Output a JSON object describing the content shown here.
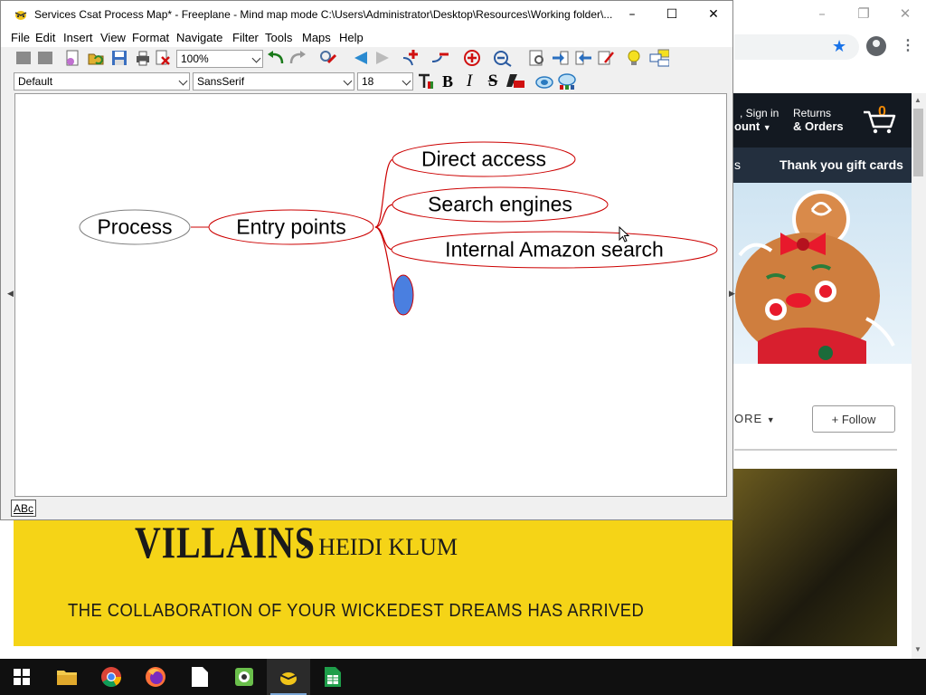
{
  "freeplane": {
    "title": "Services Csat Process Map* - Freeplane - Mind map mode C:\\Users\\Administrator\\Desktop\\Resources\\Working folder\\...",
    "menu": [
      "File",
      "Edit",
      "Insert",
      "View",
      "Format",
      "Navigate",
      "Filter",
      "Tools",
      "Maps",
      "Help"
    ],
    "zoom": "100%",
    "style": "Default",
    "font": "SansSerif",
    "font_size": "18",
    "status_abc": "ABc",
    "nodes": {
      "root": "Process",
      "entry": "Entry points",
      "direct": "Direct access",
      "search": "Search engines",
      "internal": "Internal Amazon search"
    },
    "colors": {
      "edge": "#cc0000",
      "node_border": "#cc0000",
      "root_border": "#808080",
      "new_node_fill": "#4a7fe0"
    }
  },
  "browser": {
    "sign_in_line1": ", Sign in",
    "sign_in_line2": "ount",
    "returns_line1": "Returns",
    "returns_line2": "& Orders",
    "cart_count": "0",
    "nav_partial": "s",
    "nav_gift": "Thank you gift cards",
    "store_more": "ORE",
    "follow": "+ Follow",
    "banner_title": "VILLAINS",
    "banner_collab": "× HEIDI KLUM",
    "banner_tagline": "THE COLLABORATION OF YOUR WICKEDEST DREAMS HAS ARRIVED"
  }
}
